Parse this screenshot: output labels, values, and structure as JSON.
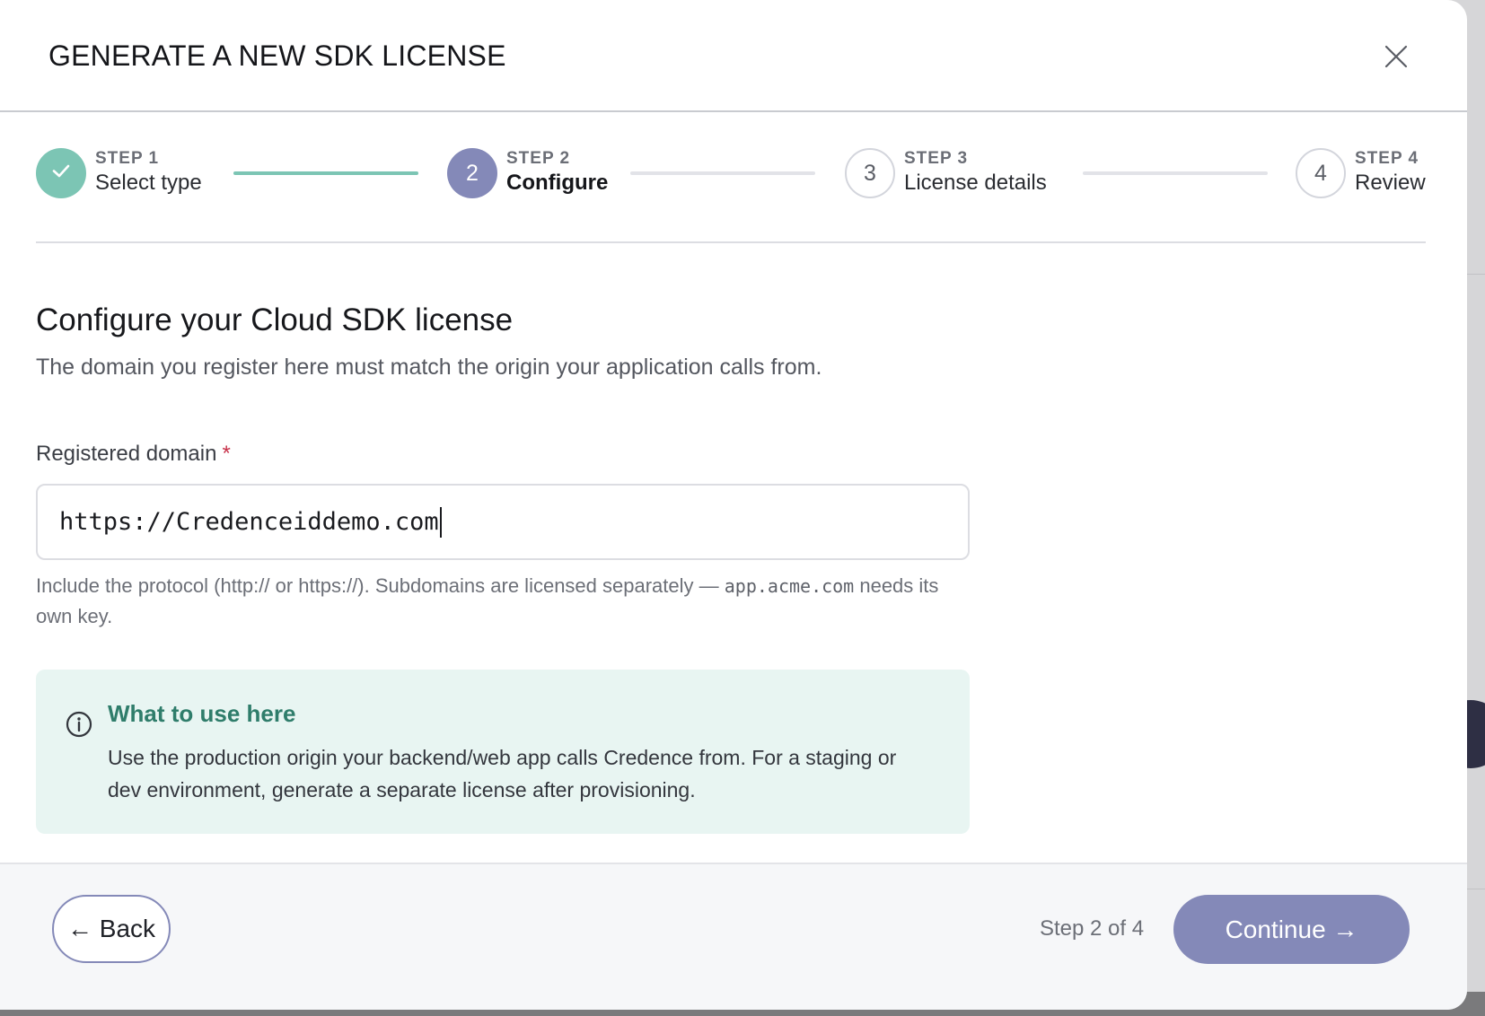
{
  "modal": {
    "title": "GENERATE A NEW SDK LICENSE"
  },
  "stepper": {
    "steps": [
      {
        "number": "STEP 1",
        "label": "Select type",
        "status": "completed",
        "badge": ""
      },
      {
        "number": "STEP 2",
        "label": "Configure",
        "status": "active",
        "badge": "2"
      },
      {
        "number": "STEP 3",
        "label": "License details",
        "status": "upcoming",
        "badge": "3"
      },
      {
        "number": "STEP 4",
        "label": "Review",
        "status": "upcoming",
        "badge": "4"
      }
    ]
  },
  "main": {
    "title": "Configure your Cloud SDK license",
    "subtitle": "The domain you register here must match the origin your application calls from.",
    "domain_field": {
      "label": "Registered domain",
      "required_marker": "*",
      "value": "https://Credenceiddemo.com",
      "help_prefix": "Include the protocol (http:// or https://). Subdomains are licensed separately — ",
      "help_code": "app.acme.com",
      "help_suffix": " needs its own key."
    },
    "info": {
      "title": "What to use here",
      "body": "Use the production origin your backend/web app calls Credence from. For a staging or dev environment, generate a separate license after provisioning."
    }
  },
  "footer": {
    "back_label": "← Back",
    "step_count": "Step 2 of 4",
    "continue_label": "Continue →"
  },
  "colors": {
    "accent": "#8489b8",
    "completed": "#7cc5b4",
    "info_bg": "#e8f5f2",
    "info_title": "#2f7d6b",
    "required": "#c8324a"
  },
  "icons": {
    "close": "close-icon",
    "check": "check-icon",
    "info": "info-icon"
  }
}
